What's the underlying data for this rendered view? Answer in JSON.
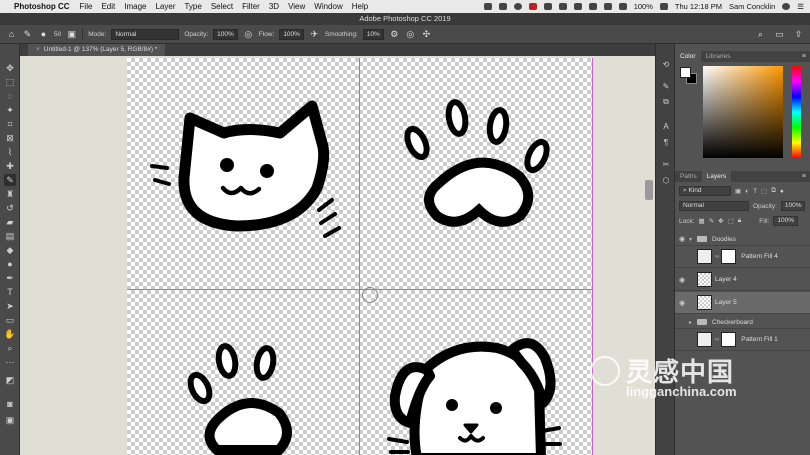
{
  "menubar": {
    "app_name": "Photoshop CC",
    "menus": [
      "File",
      "Edit",
      "Image",
      "Layer",
      "Type",
      "Select",
      "Filter",
      "3D",
      "View",
      "Window",
      "Help"
    ],
    "battery": "100%",
    "clock": "Thu 12:18 PM",
    "user": "Sam Concklin"
  },
  "window": {
    "title": "Adobe Photoshop CC 2019"
  },
  "options_bar": {
    "brush_size": "50",
    "mode_label": "Mode:",
    "mode_value": "Normal",
    "opacity_label": "Opacity:",
    "opacity_value": "100%",
    "flow_label": "Flow:",
    "flow_value": "100%",
    "smoothing_label": "Smoothing:",
    "smoothing_value": "10%"
  },
  "document": {
    "tab_title": "Untitled-1 @ 137% (Layer 5, RGB/8#) *"
  },
  "color_panel": {
    "tabs": [
      "Color",
      "Libraries"
    ],
    "foreground": "#ffffff",
    "background": "#000000",
    "hue_accent": "#ff9900"
  },
  "layers_panel": {
    "tabs": [
      "Paths",
      "Layers"
    ],
    "filter_label": "Kind",
    "blend_mode": "Normal",
    "opacity_label": "Opacity:",
    "opacity_value": "100%",
    "lock_label": "Lock:",
    "fill_label": "Fill:",
    "fill_value": "100%",
    "layers": [
      {
        "name": "Doodles",
        "type": "group",
        "visible": true,
        "expanded": true
      },
      {
        "name": "Pattern Fill 4",
        "type": "fill",
        "visible": false
      },
      {
        "name": "Layer 4",
        "type": "pixel",
        "visible": true
      },
      {
        "name": "Layer 5",
        "type": "pixel",
        "visible": true,
        "selected": true
      },
      {
        "name": "Checkerboard",
        "type": "group",
        "visible": false,
        "expanded": false
      },
      {
        "name": "Pattern Fill 1",
        "type": "fill",
        "visible": false
      }
    ]
  },
  "watermark": {
    "brand_cn": "灵感中国",
    "url": "lingganchina.com"
  }
}
